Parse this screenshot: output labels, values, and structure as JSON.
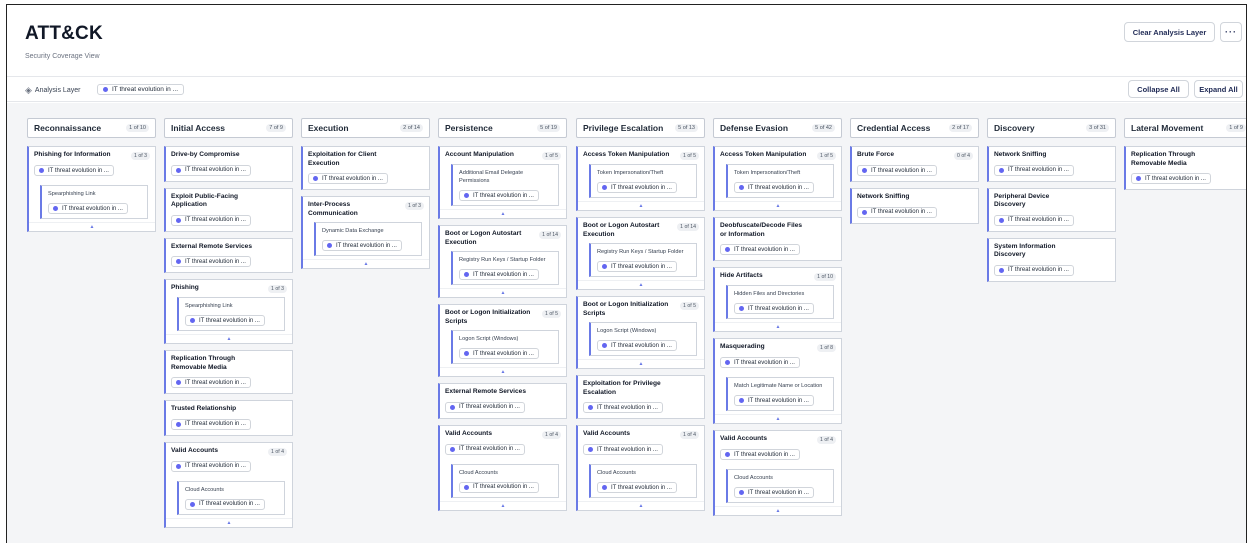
{
  "header": {
    "title": "ATT&CK",
    "subtitle": "Security Coverage View",
    "clear_label": "Clear Analysis Layer",
    "more_label": "···"
  },
  "toolbar": {
    "layer_label": "Analysis Layer",
    "layer_chip": "IT threat evolution in ...",
    "collapse_label": "Collapse All",
    "expand_label": "Expand All"
  },
  "colors": {
    "accent": "#6a7ae6",
    "dot": "#6366f1"
  },
  "chip_text": "IT threat evolution in ...",
  "columns": [
    {
      "name": "Reconnaissance",
      "count": "1 of 10",
      "techniques": [
        {
          "name": "Phishing for Information",
          "badge": "1 of 3",
          "chip": true,
          "subs": [
            {
              "name": "Spearphishing Link"
            }
          ],
          "expand": true
        }
      ]
    },
    {
      "name": "Initial Access",
      "count": "7 of 9",
      "techniques": [
        {
          "name": "Drive-by Compromise",
          "chip": true
        },
        {
          "name": "Exploit Public-Facing Application",
          "chip": true
        },
        {
          "name": "External Remote Services",
          "chip": true
        },
        {
          "name": "Phishing",
          "badge": "1 of 3",
          "chip": false,
          "subs": [
            {
              "name": "Spearphishing Link"
            }
          ],
          "expand": true
        },
        {
          "name": "Replication Through Removable Media",
          "chip": true
        },
        {
          "name": "Trusted Relationship",
          "chip": true
        },
        {
          "name": "Valid Accounts",
          "badge": "1 of 4",
          "chip": true,
          "subs": [
            {
              "name": "Cloud Accounts"
            }
          ],
          "expand": true
        }
      ]
    },
    {
      "name": "Execution",
      "count": "2 of 14",
      "techniques": [
        {
          "name": "Exploitation for Client Execution",
          "chip": true
        },
        {
          "name": "Inter-Process Communication",
          "badge": "1 of 3",
          "chip": false,
          "subs": [
            {
              "name": "Dynamic Data Exchange"
            }
          ],
          "expand": true
        }
      ]
    },
    {
      "name": "Persistence",
      "count": "5 of 19",
      "techniques": [
        {
          "name": "Account Manipulation",
          "badge": "1 of 5",
          "chip": false,
          "subs": [
            {
              "name": "Additional Email Delegate Permissions"
            }
          ],
          "expand": true
        },
        {
          "name": "Boot or Logon Autostart Execution",
          "badge": "1 of 14",
          "chip": false,
          "subs": [
            {
              "name": "Registry Run Keys / Startup Folder"
            }
          ],
          "expand": true
        },
        {
          "name": "Boot or Logon Initialization Scripts",
          "badge": "1 of 5",
          "chip": false,
          "subs": [
            {
              "name": "Logon Script (Windows)"
            }
          ],
          "expand": true
        },
        {
          "name": "External Remote Services",
          "chip": true
        },
        {
          "name": "Valid Accounts",
          "badge": "1 of 4",
          "chip": true,
          "subs": [
            {
              "name": "Cloud Accounts"
            }
          ],
          "expand": true
        }
      ]
    },
    {
      "name": "Privilege Escalation",
      "count": "5 of 13",
      "techniques": [
        {
          "name": "Access Token Manipulation",
          "badge": "1 of 5",
          "chip": false,
          "subs": [
            {
              "name": "Token Impersonation/Theft"
            }
          ],
          "expand": true
        },
        {
          "name": "Boot or Logon Autostart Execution",
          "badge": "1 of 14",
          "chip": false,
          "subs": [
            {
              "name": "Registry Run Keys / Startup Folder"
            }
          ],
          "expand": true
        },
        {
          "name": "Boot or Logon Initialization Scripts",
          "badge": "1 of 5",
          "chip": false,
          "subs": [
            {
              "name": "Logon Script (Windows)"
            }
          ],
          "expand": true
        },
        {
          "name": "Exploitation for Privilege Escalation",
          "chip": true
        },
        {
          "name": "Valid Accounts",
          "badge": "1 of 4",
          "chip": true,
          "subs": [
            {
              "name": "Cloud Accounts"
            }
          ],
          "expand": true
        }
      ]
    },
    {
      "name": "Defense Evasion",
      "count": "5 of 42",
      "techniques": [
        {
          "name": "Access Token Manipulation",
          "badge": "1 of 5",
          "chip": false,
          "subs": [
            {
              "name": "Token Impersonation/Theft"
            }
          ],
          "expand": true
        },
        {
          "name": "Deobfuscate/Decode Files or Information",
          "chip": true
        },
        {
          "name": "Hide Artifacts",
          "badge": "1 of 10",
          "chip": false,
          "subs": [
            {
              "name": "Hidden Files and Directories"
            }
          ],
          "expand": true
        },
        {
          "name": "Masquerading",
          "badge": "1 of 8",
          "chip": true,
          "subs": [
            {
              "name": "Match Legitimate Name or Location"
            }
          ],
          "expand": true
        },
        {
          "name": "Valid Accounts",
          "badge": "1 of 4",
          "chip": true,
          "subs": [
            {
              "name": "Cloud Accounts"
            }
          ],
          "expand": true
        }
      ]
    },
    {
      "name": "Credential Access",
      "count": "2 of 17",
      "techniques": [
        {
          "name": "Brute Force",
          "badge": "0 of 4",
          "chip": true
        },
        {
          "name": "Network Sniffing",
          "chip": true
        }
      ]
    },
    {
      "name": "Discovery",
      "count": "3 of 31",
      "techniques": [
        {
          "name": "Network Sniffing",
          "chip": true
        },
        {
          "name": "Peripheral Device Discovery",
          "chip": true
        },
        {
          "name": "System Information Discovery",
          "chip": true
        }
      ]
    },
    {
      "name": "Lateral Movement",
      "count": "1 of 9",
      "techniques": [
        {
          "name": "Replication Through Removable Media",
          "chip": true
        }
      ]
    }
  ]
}
